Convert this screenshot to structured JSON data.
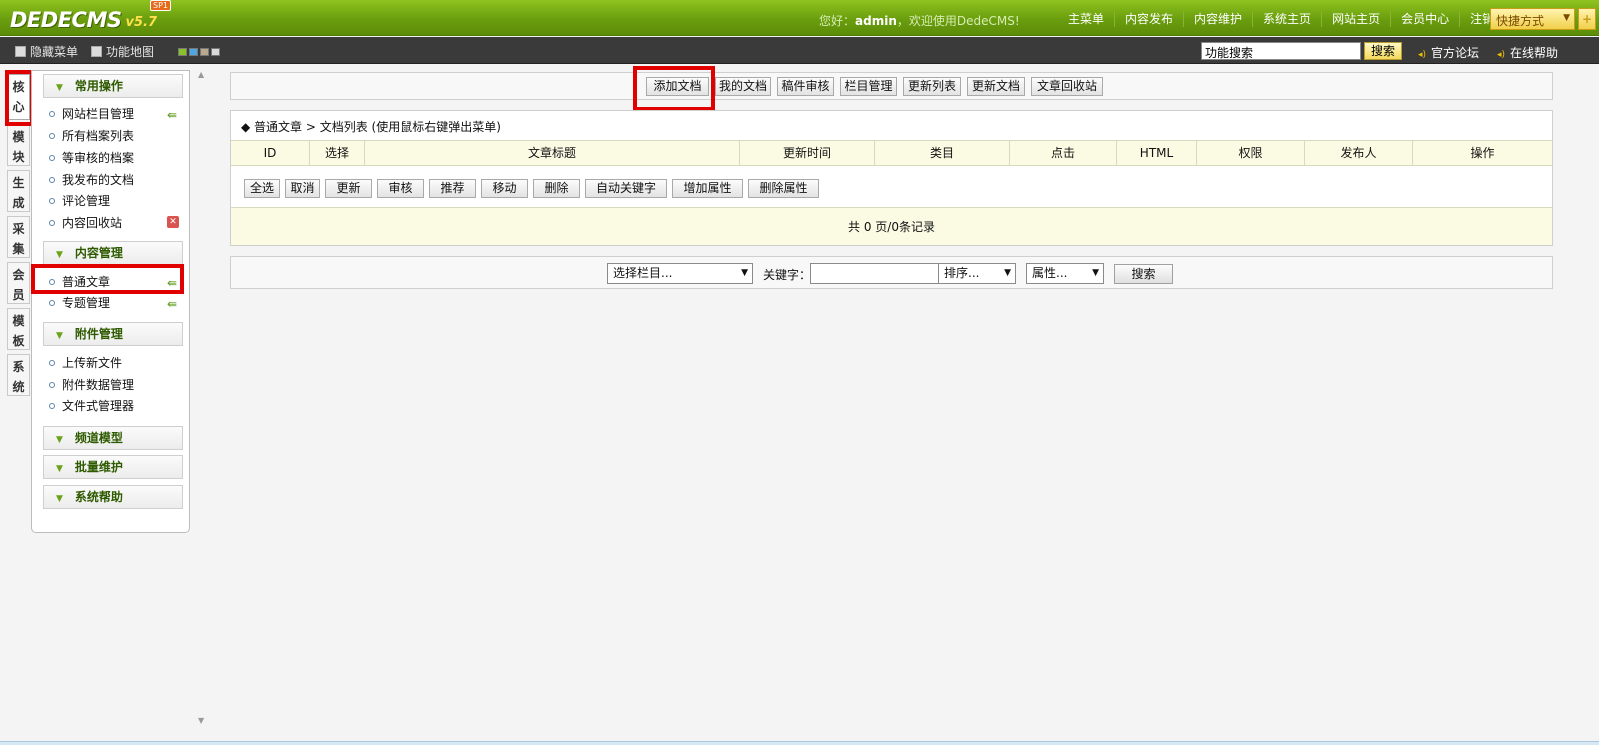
{
  "header": {
    "logo_text": "DEDECMS",
    "logo_version": "v5.7",
    "logo_badge": "SP1",
    "welcome_prefix": "您好：",
    "welcome_user": "admin",
    "welcome_suffix": "，欢迎使用DedeCMS!",
    "nav": [
      "主菜单",
      "内容发布",
      "内容维护",
      "系统主页",
      "网站主页",
      "会员中心",
      "注销"
    ],
    "quick_label": "快捷方式",
    "plus_label": "+"
  },
  "subbar": {
    "hide_menu": "隐藏菜单",
    "site_map": "功能地图",
    "search_value": "功能搜索",
    "search_button": "搜索",
    "forum_link": "官方论坛",
    "help_link": "在线帮助"
  },
  "vtabs": [
    "核心",
    "模块",
    "生成",
    "采集",
    "会员",
    "模板",
    "系统"
  ],
  "menu": {
    "groups": [
      "常用操作",
      "内容管理",
      "附件管理",
      "频道模型",
      "批量维护",
      "系统帮助"
    ],
    "common_items": [
      "网站栏目管理",
      "所有档案列表",
      "等审核的档案",
      "我发布的文档",
      "评论管理",
      "内容回收站"
    ],
    "content_items": [
      "普通文章",
      "专题管理"
    ],
    "attach_items": [
      "上传新文件",
      "附件数据管理",
      "文件式管理器"
    ]
  },
  "toolbar": [
    "添加文档",
    "我的文档",
    "稿件审核",
    "栏目管理",
    "更新列表",
    "更新文档",
    "文章回收站"
  ],
  "list": {
    "breadcrumb": "◆ 普通文章 > 文档列表  (使用鼠标右键弹出菜单)",
    "columns": [
      "ID",
      "选择",
      "文章标题",
      "更新时间",
      "类目",
      "点击",
      "HTML",
      "权限",
      "发布人",
      "操作"
    ],
    "actions": [
      "全选",
      "取消",
      "更新",
      "审核",
      "推荐",
      "移动",
      "删除",
      "自动关键字",
      "增加属性",
      "删除属性"
    ],
    "pager": "共 0 页/0条记录"
  },
  "filter": {
    "category_select": "选择栏目...",
    "keyword_label": "关键字：",
    "keyword_value": "",
    "sort_select": "排序...",
    "attr_select": "属性...",
    "search_button": "搜索"
  },
  "colors": {
    "header_green": "#6a9e0e",
    "highlight_red": "#e00000"
  }
}
